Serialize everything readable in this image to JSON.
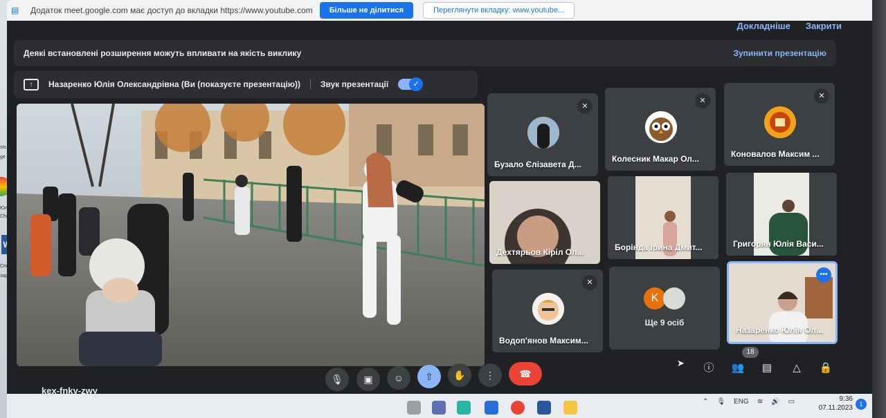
{
  "sharing_bar": {
    "message": "Додаток meet.google.com має доступ до вкладки https://www.youtube.com",
    "stop_sharing": "Більше не ділитися",
    "view_tab": "Переглянути вкладку: www.youtube..."
  },
  "info_row": {
    "more_link": "Докладніше",
    "close_link": "Закрити"
  },
  "warning": {
    "text": "Деякі встановлені розширення можуть впливати на якість виклику",
    "stop_presenting": "Зупинити презентацію"
  },
  "presenter": {
    "name": "Назаренко Юлія Олександрівна (Ви (показуєте презентацію))",
    "sound_label": "Звук презентації",
    "sound_on": true
  },
  "participants": [
    {
      "name": "Бузало Єлізавета Д...",
      "muted": true
    },
    {
      "name": "Колесник Макар Ол...",
      "muted": true
    },
    {
      "name": "Коновалов Максим ...",
      "muted": true
    },
    {
      "name": "Дехтярьов Кiрiл Ол...",
      "muted": true
    },
    {
      "name": "Борінда Ірина Дмит...",
      "muted": true
    },
    {
      "name": "Григорян Юлія Васи...",
      "muted": true
    },
    {
      "name": "Водоп'янов Максим...",
      "muted": true
    },
    {
      "name": "Ще 9 осіб",
      "initial": "K"
    },
    {
      "name": "Назаренко Юлія Ол...",
      "active": true
    }
  ],
  "meeting": {
    "code": "kex-fnky-zwy",
    "people_count": "18"
  },
  "taskbar": {
    "lang": "ENG",
    "time": "9:36",
    "date": "07.11.2023",
    "notifications": "1"
  },
  "desktop_left": {
    "label1": "sts",
    "label2": "ge",
    "label3": "Юлі",
    "label4": "Chr",
    "label5": "Спо",
    "label6": "зара"
  }
}
